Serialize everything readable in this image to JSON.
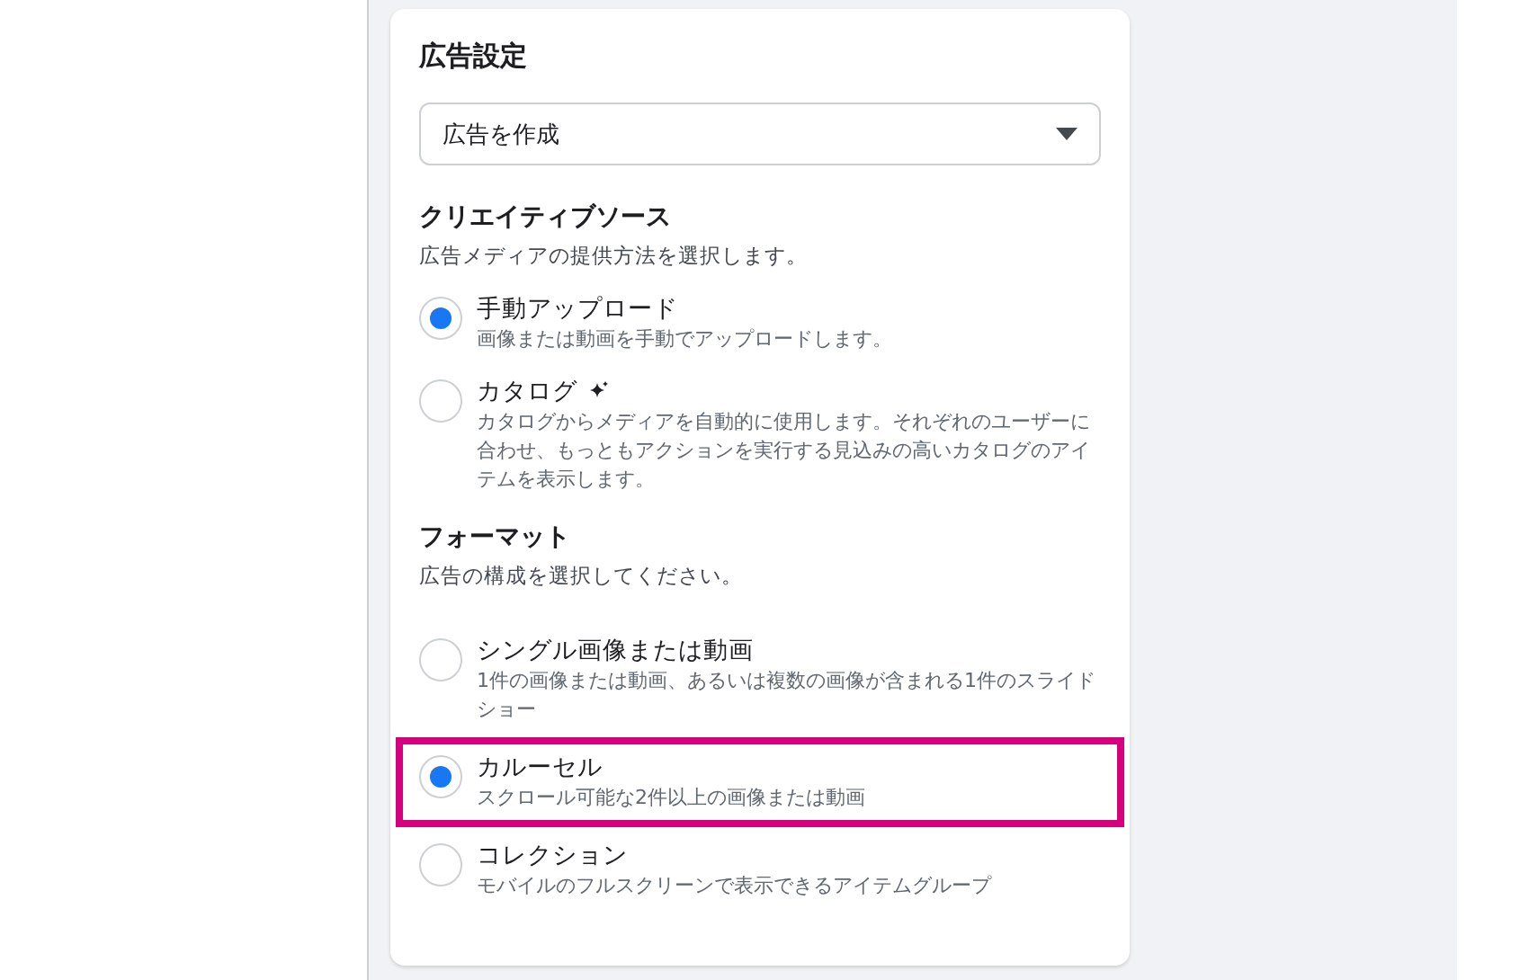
{
  "card": {
    "title": "広告設定",
    "dropdown": {
      "value": "広告を作成"
    },
    "sections": [
      {
        "heading": "クリエイティブソース",
        "description": "広告メディアの提供方法を選択します。",
        "options": [
          {
            "label": "手動アップロード",
            "description": "画像または動画を手動でアップロードします。",
            "selected": true,
            "highlighted": false,
            "sparkle": false
          },
          {
            "label": "カタログ",
            "description": "カタログからメディアを自動的に使用します。それぞれのユーザーに合わせ、もっともアクションを実行する見込みの高いカタログのアイテムを表示します。",
            "selected": false,
            "highlighted": false,
            "sparkle": true
          }
        ]
      },
      {
        "heading": "フォーマット",
        "description": "広告の構成を選択してください。",
        "options": [
          {
            "label": "シングル画像または動画",
            "description": "1件の画像または動画、あるいは複数の画像が含まれる1件のスライドショー",
            "selected": false,
            "highlighted": false,
            "sparkle": false
          },
          {
            "label": "カルーセル",
            "description": "スクロール可能な2件以上の画像または動画",
            "selected": true,
            "highlighted": true,
            "sparkle": false
          },
          {
            "label": "コレクション",
            "description": "モバイルのフルスクリーンで表示できるアイテムグループ",
            "selected": false,
            "highlighted": false,
            "sparkle": false
          }
        ]
      }
    ]
  }
}
